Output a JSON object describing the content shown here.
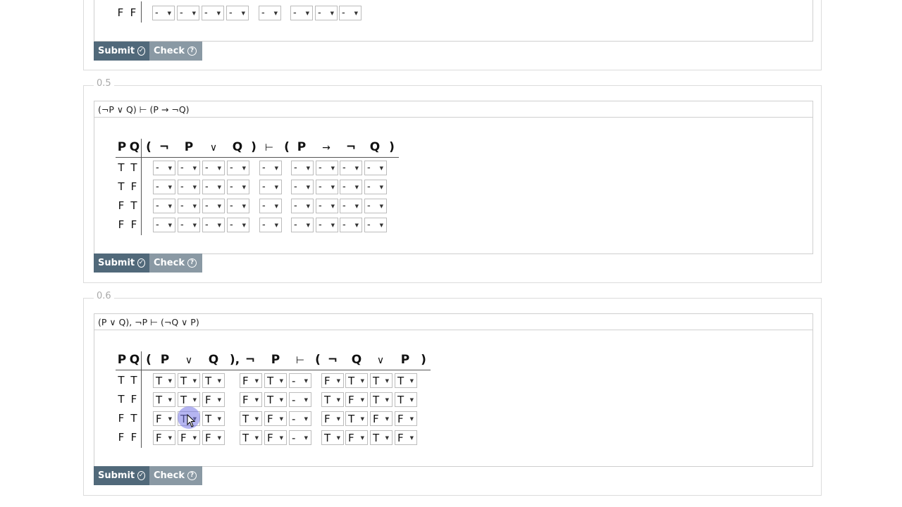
{
  "prev": {
    "row_label": [
      "F",
      "F"
    ],
    "cells": [
      "-",
      "-",
      "-",
      "-",
      "-",
      "-",
      "-",
      "-"
    ],
    "submit_label": "Submit",
    "check_label": "Check"
  },
  "q5": {
    "legend": "0.5",
    "formula": "(¬P ∨ Q) ⊢ (P → ¬Q)",
    "header_vars": [
      "P",
      "Q"
    ],
    "header_syms": [
      "(",
      "¬",
      "P",
      "∨",
      "Q",
      ")",
      "⊢",
      "(",
      "P",
      "→",
      "¬",
      "Q",
      ")"
    ],
    "rows": [
      {
        "label": [
          "T",
          "T"
        ],
        "cells": [
          "-",
          "-",
          "-",
          "-",
          "-",
          "-",
          "-",
          "-",
          "-"
        ]
      },
      {
        "label": [
          "T",
          "F"
        ],
        "cells": [
          "-",
          "-",
          "-",
          "-",
          "-",
          "-",
          "-",
          "-",
          "-"
        ]
      },
      {
        "label": [
          "F",
          "T"
        ],
        "cells": [
          "-",
          "-",
          "-",
          "-",
          "-",
          "-",
          "-",
          "-",
          "-"
        ]
      },
      {
        "label": [
          "F",
          "F"
        ],
        "cells": [
          "-",
          "-",
          "-",
          "-",
          "-",
          "-",
          "-",
          "-",
          "-"
        ]
      }
    ],
    "submit_label": "Submit",
    "check_label": "Check"
  },
  "q6": {
    "legend": "0.6",
    "formula": "(P ∨ Q), ¬P ⊢ (¬Q ∨ P)",
    "header_vars": [
      "P",
      "Q"
    ],
    "header_syms": [
      "(",
      "P",
      "∨",
      "Q",
      "),",
      "¬",
      "P",
      "⊢",
      "(",
      "¬",
      "Q",
      "∨",
      "P",
      ")"
    ],
    "rows": [
      {
        "label": [
          "T",
          "T"
        ],
        "cells": [
          "T",
          "T",
          "T",
          "F",
          "T",
          "-",
          "F",
          "T",
          "T",
          "T"
        ]
      },
      {
        "label": [
          "T",
          "F"
        ],
        "cells": [
          "T",
          "T",
          "F",
          "F",
          "T",
          "-",
          "T",
          "F",
          "T",
          "T"
        ]
      },
      {
        "label": [
          "F",
          "T"
        ],
        "cells": [
          "F",
          "T",
          "T",
          "T",
          "F",
          "-",
          "F",
          "T",
          "F",
          "F"
        ]
      },
      {
        "label": [
          "F",
          "F"
        ],
        "cells": [
          "F",
          "F",
          "F",
          "T",
          "F",
          "-",
          "T",
          "F",
          "T",
          "F"
        ]
      }
    ],
    "submit_label": "Submit",
    "check_label": "Check"
  }
}
